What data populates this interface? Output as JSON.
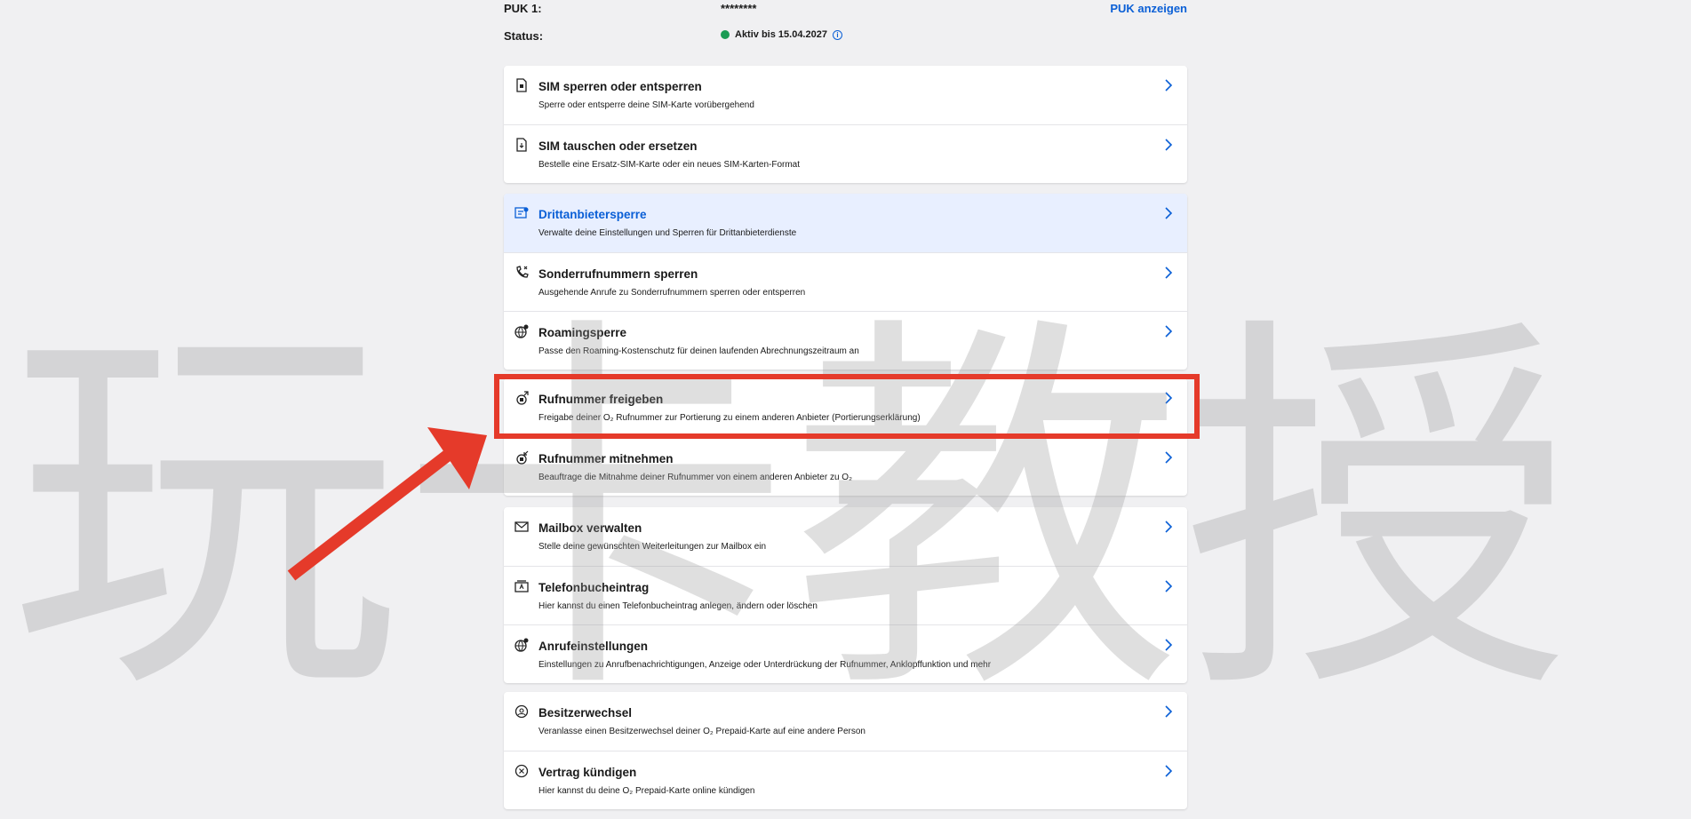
{
  "header": {
    "puk_label": "PUK 1:",
    "puk_value": "********",
    "puk_link": "PUK anzeigen",
    "status_label": "Status:",
    "status_value": "Aktiv bis 15.04.2027",
    "status_color": "#1a9c54"
  },
  "cards": [
    {
      "items": [
        {
          "title": "SIM sperren oder entsperren",
          "subtitle": "Sperre oder entsperre deine SIM-Karte vorübergehend",
          "icon": "sim-lock-icon"
        },
        {
          "title": "SIM tauschen oder ersetzen",
          "subtitle": "Bestelle eine Ersatz-SIM-Karte oder ein neues SIM-Karten-Format",
          "icon": "sim-swap-icon"
        }
      ]
    },
    {
      "items": [
        {
          "title": "Drittanbietersperre",
          "subtitle": "Verwalte deine Einstellungen und Sperren für Drittanbieterdienste",
          "icon": "third-party-block-icon",
          "active": true
        },
        {
          "title": "Sonderrufnummern sperren",
          "subtitle": "Ausgehende Anrufe zu Sonderrufnummern sperren oder entsperren",
          "icon": "phone-block-icon"
        },
        {
          "title": "Roamingsperre",
          "subtitle": "Passe den Roaming-Kostenschutz für deinen laufenden Abrechnungszeitraum an",
          "icon": "globe-icon"
        }
      ]
    },
    {
      "items": [
        {
          "title": "Rufnummer freigeben",
          "subtitle": "Freigabe deiner O₂ Rufnummer zur Portierung zu einem anderen Anbieter (Portierungserklärung)",
          "icon": "sim-export-icon"
        },
        {
          "title": "Rufnummer mitnehmen",
          "subtitle": "Beauftrage die Mitnahme deiner Rufnummer von einem anderen Anbieter zu O₂",
          "icon": "sim-import-icon"
        }
      ]
    },
    {
      "items": [
        {
          "title": "Mailbox verwalten",
          "subtitle": "Stelle deine gewünschten Weiterleitungen zur Mailbox ein",
          "icon": "mail-icon"
        },
        {
          "title": "Telefonbucheintrag",
          "subtitle": "Hier kannst du einen Telefonbucheintrag anlegen, ändern oder löschen",
          "icon": "phonebook-icon"
        },
        {
          "title": "Anrufeinstellungen",
          "subtitle": "Einstellungen zu Anrufbenachrichtigungen, Anzeige oder Unterdrückung der Rufnummer, Anklopffunktion und mehr",
          "icon": "call-settings-icon"
        }
      ]
    },
    {
      "items": [
        {
          "title": "Besitzerwechsel",
          "subtitle": "Veranlasse einen Besitzerwechsel deiner O₂ Prepaid-Karte auf eine andere Person",
          "icon": "owner-change-icon"
        },
        {
          "title": "Vertrag kündigen",
          "subtitle": "Hier kannst du deine O₂ Prepaid-Karte online kündigen",
          "icon": "cancel-icon"
        }
      ]
    }
  ],
  "watermark": "玩卡教授",
  "colors": {
    "accent": "#0a5fd6",
    "highlight": "#e53a2a",
    "active_row": "#e8efff"
  }
}
